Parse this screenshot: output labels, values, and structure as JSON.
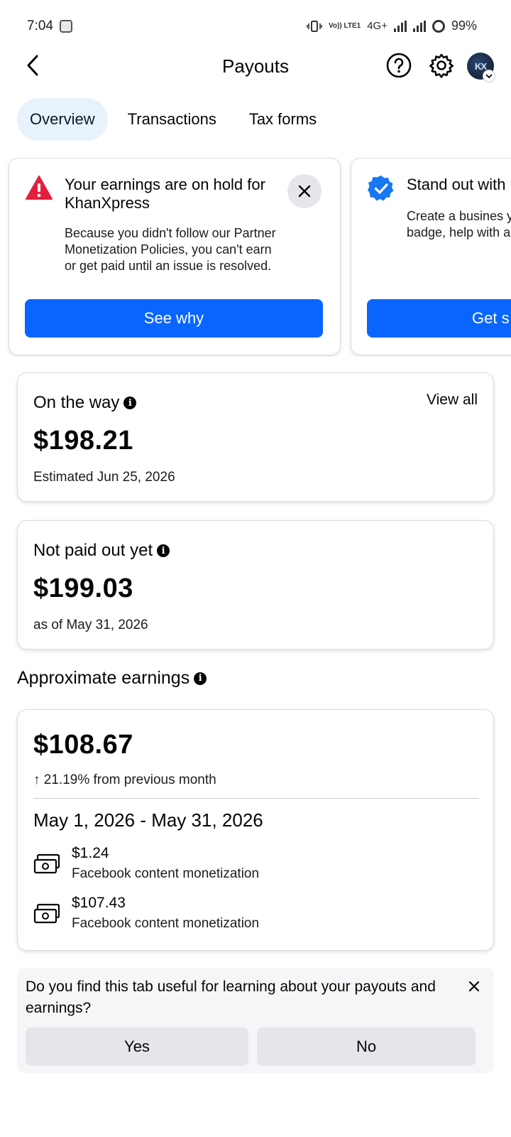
{
  "status_bar": {
    "time": "7:04",
    "network_top": "Vo)) LTE1",
    "network_type": "4G+",
    "battery": "99%"
  },
  "header": {
    "title": "Payouts",
    "avatar_initials": "KX"
  },
  "tabs": [
    {
      "label": "Overview",
      "active": true
    },
    {
      "label": "Transactions",
      "active": false
    },
    {
      "label": "Tax forms",
      "active": false
    }
  ],
  "alerts": [
    {
      "icon": "warning-triangle-icon",
      "title": "Your earnings are on hold for KhanXpress",
      "body": "Because you didn't follow our Partner Monetization Policies, you can't earn or get paid until an issue is resolved.",
      "button": "See why"
    },
    {
      "icon": "verified-badge-icon",
      "title": "Stand out with",
      "body": "Create a busines you can subscrib badge, help with account protecti",
      "button": "Get s"
    }
  ],
  "on_the_way": {
    "heading": "On the way",
    "link": "View all",
    "amount": "$198.21",
    "note": "Estimated Jun 25, 2026"
  },
  "not_paid": {
    "heading": "Not paid out yet",
    "amount": "$199.03",
    "note": "as of May 31, 2026"
  },
  "approximate": {
    "heading": "Approximate earnings",
    "amount": "$108.67",
    "change": "↑ 21.19% from previous month",
    "range": "May 1, 2026 - May 31, 2026",
    "items": [
      {
        "amount": "$1.24",
        "label": "Facebook content monetization"
      },
      {
        "amount": "$107.43",
        "label": "Facebook content monetization"
      }
    ]
  },
  "feedback": {
    "question": "Do you find this tab useful for learning about your payouts and earnings?",
    "yes": "Yes",
    "no": "No"
  },
  "colors": {
    "accent": "#0866ff",
    "alert_red": "#e41e3f",
    "verified_blue": "#1877f2",
    "tab_active_bg": "#e7f2fd"
  }
}
